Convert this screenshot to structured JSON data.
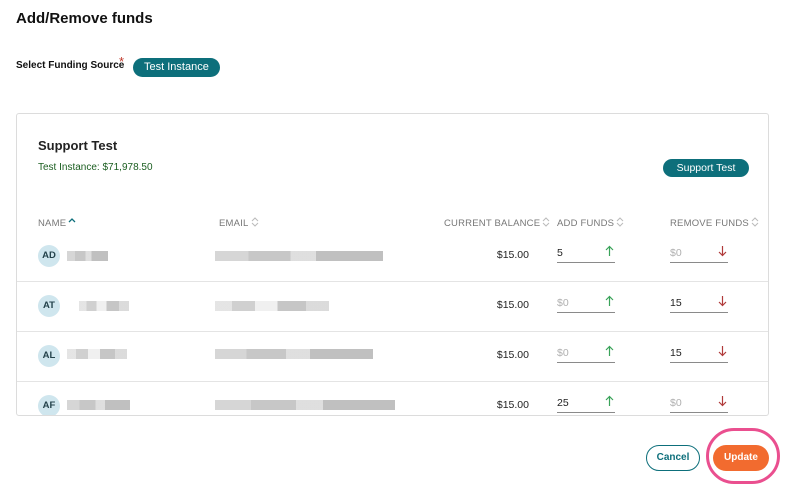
{
  "page": {
    "title": "Add/Remove funds",
    "funding_source_label": "Select Funding Source",
    "required_mark": "*",
    "funding_source_selected": "Test Instance"
  },
  "card": {
    "title": "Support Test",
    "balance_line": "Test Instance: $71,978.50",
    "badge": "Support Test"
  },
  "table": {
    "headers": [
      "NAME",
      "EMAIL",
      "CURRENT BALANCE",
      "ADD FUNDS",
      "REMOVE FUNDS"
    ],
    "rows": [
      {
        "initials": "AD",
        "balance": "$15.00",
        "add": "5",
        "remove": "$0"
      },
      {
        "initials": "AT",
        "balance": "$15.00",
        "add": "$0",
        "remove": "15"
      },
      {
        "initials": "AL",
        "balance": "$15.00",
        "add": "$0",
        "remove": "15"
      },
      {
        "initials": "AF",
        "balance": "$15.00",
        "add": "25",
        "remove": "$0"
      }
    ]
  },
  "actions": {
    "cancel": "Cancel",
    "update": "Update"
  },
  "colors": {
    "primary": "#0d6f7b",
    "update": "#f26b2f",
    "highlight": "#ea4f8f",
    "add_arrow": "#3aa35a",
    "remove_arrow": "#b03a3a",
    "balance_text": "#1b5e20"
  },
  "icons": {
    "sort": "sort-icon",
    "add": "arrow-up-icon",
    "remove": "arrow-down-icon"
  }
}
